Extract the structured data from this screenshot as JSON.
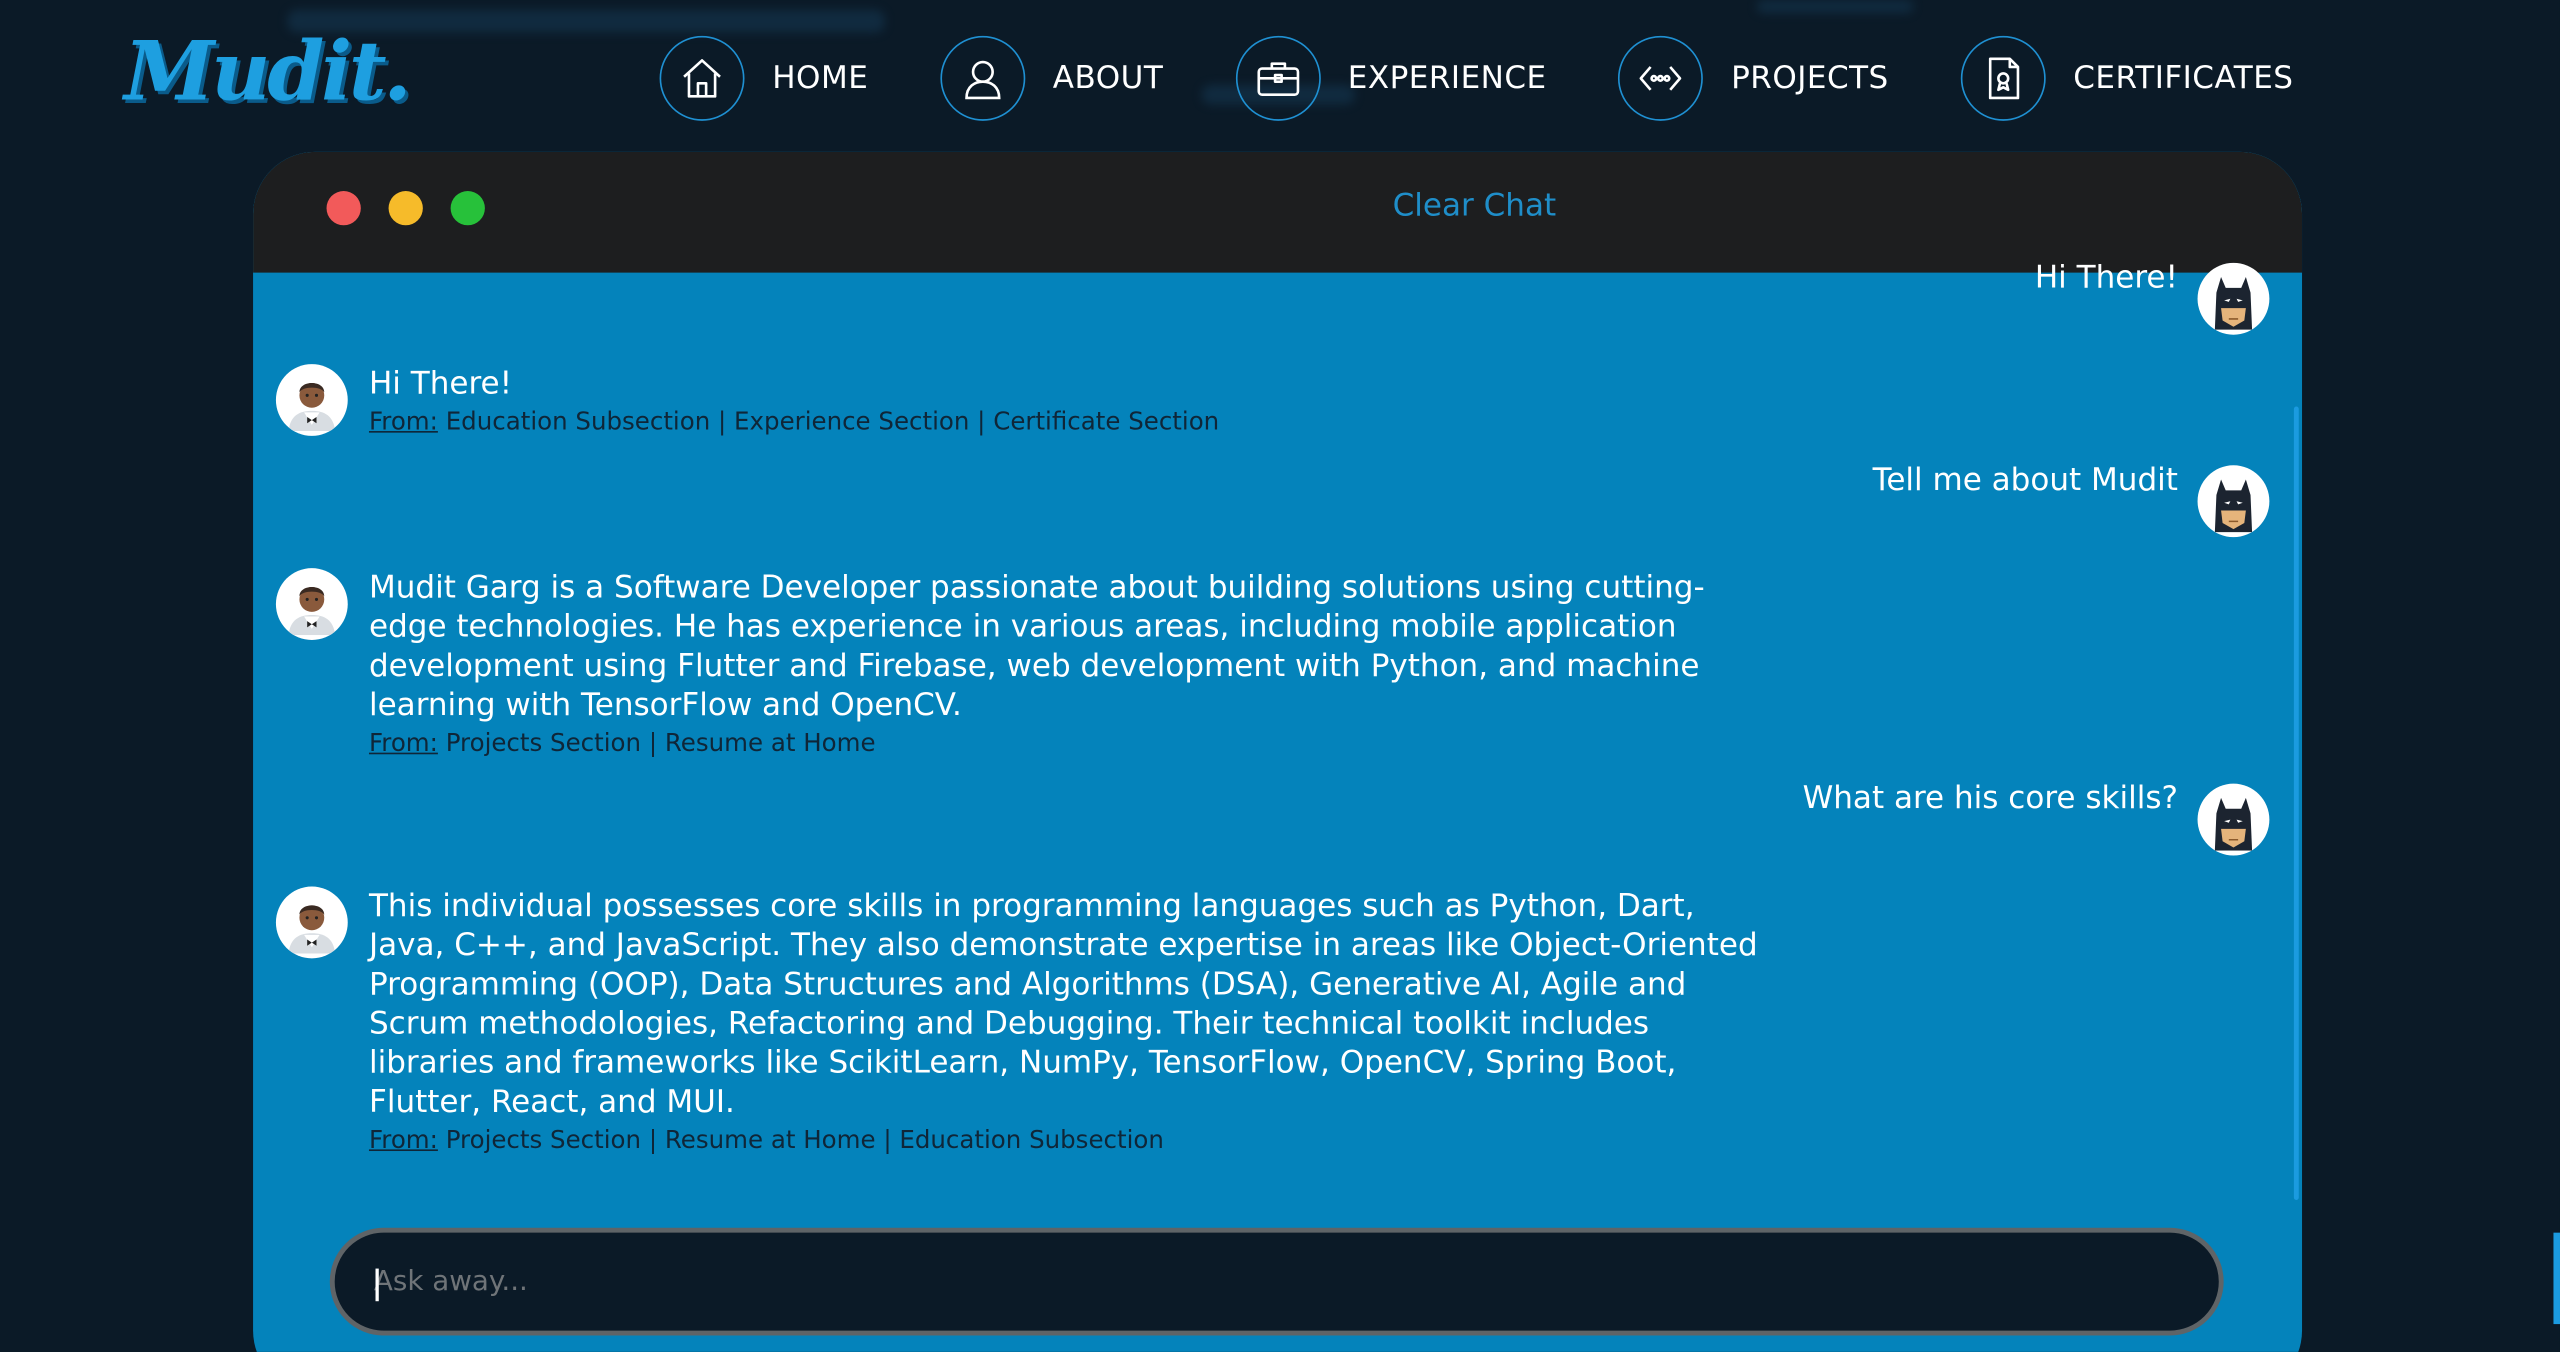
{
  "brand": {
    "logo_text": "Mudit",
    "logo_dot": "."
  },
  "nav": {
    "items": [
      {
        "label": "HOME",
        "icon": "home-icon"
      },
      {
        "label": "ABOUT",
        "icon": "user-icon"
      },
      {
        "label": "EXPERIENCE",
        "icon": "briefcase-icon"
      },
      {
        "label": "PROJECTS",
        "icon": "code-icon"
      },
      {
        "label": "CERTIFICATES",
        "icon": "certificate-icon"
      }
    ]
  },
  "chat": {
    "clear_label": "Clear Chat",
    "from_label": "From:",
    "messages": [
      {
        "role": "user",
        "text": "Hi There!"
      },
      {
        "role": "bot",
        "text": "Hi There!",
        "sources": "Education Subsection | Experience Section | Certificate Section"
      },
      {
        "role": "user",
        "text": "Tell me about Mudit"
      },
      {
        "role": "bot",
        "text": "Mudit Garg is a Software Developer passionate about building solutions using cutting-edge technologies. He has experience in various areas, including mobile application development using Flutter and Firebase, web development with Python, and machine learning with TensorFlow and OpenCV.",
        "sources": "Projects Section | Resume at Home"
      },
      {
        "role": "user",
        "text": "What are his core skills?"
      },
      {
        "role": "bot",
        "text": "This individual possesses core skills in programming languages such as Python, Dart, Java, C++, and JavaScript. They also demonstrate expertise in areas like Object-Oriented Programming (OOP), Data Structures and Algorithms (DSA), Generative AI, Agile and Scrum methodologies, Refactoring and Debugging. Their technical toolkit includes libraries and frameworks like ScikitLearn, NumPy, TensorFlow, OpenCV, Spring Boot, Flutter, React, and MUI.",
        "sources": "Projects Section | Resume at Home | Education Subsection"
      }
    ],
    "input": {
      "placeholder": "Ask away...",
      "value": ""
    }
  },
  "colors": {
    "background": "#0b1a27",
    "chat_body": "#0483bb",
    "chat_header": "#1d1e1f",
    "accent": "#1f90d2",
    "close": "#f25a5a",
    "minimize": "#f6bb2a",
    "maximize": "#27c13a"
  }
}
